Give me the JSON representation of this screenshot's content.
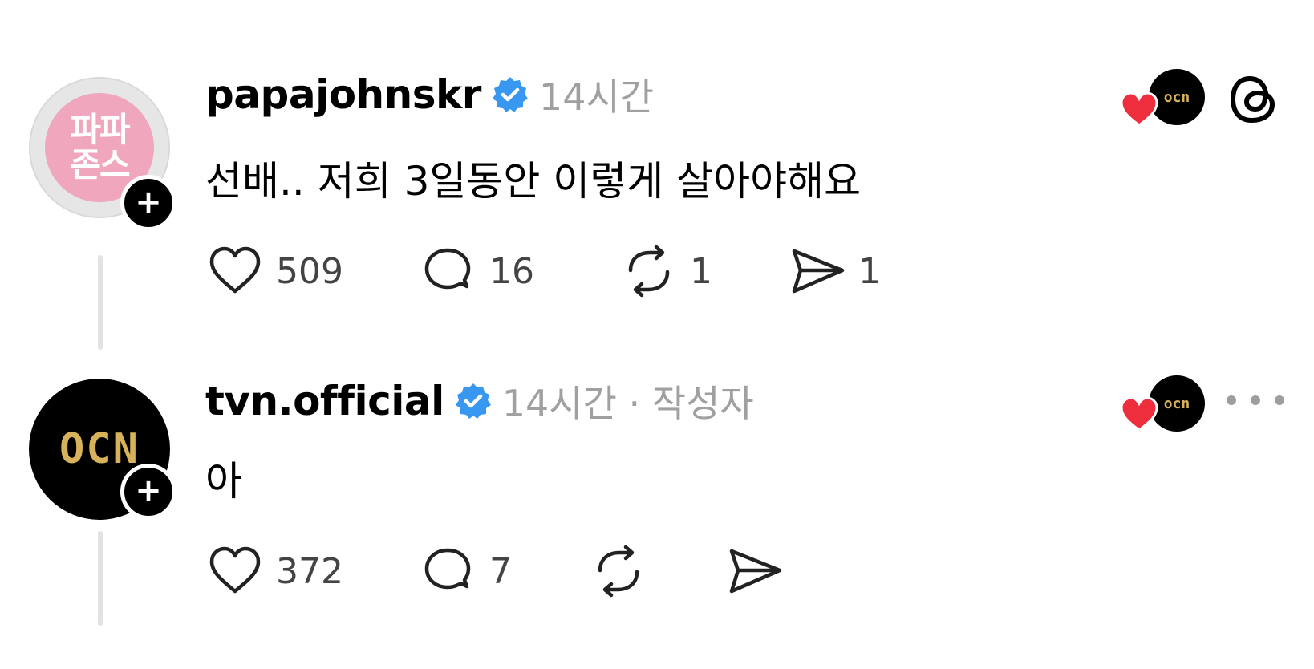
{
  "posts": [
    {
      "username": "papajohnskr",
      "time": "14시간",
      "text": "선배.. 저희 3일동안 이렇게 살아야해요",
      "avatar_text": [
        "파파",
        "존스"
      ],
      "top_right_avatar_text": "ocn",
      "actions": {
        "likes": "509",
        "comments": "16",
        "reposts": "1",
        "shares": "1"
      },
      "right_icon": "threads-logo-icon"
    },
    {
      "username": "tvn.official",
      "time": "14시간 · 작성자",
      "text": "아",
      "avatar_text": "OCN",
      "top_right_avatar_text": "ocn",
      "actions": {
        "likes": "372",
        "comments": "7",
        "reposts": "",
        "shares": ""
      },
      "right_icon": "more-icon"
    }
  ],
  "colors": {
    "verified": "#3897f0",
    "heart": "#ee2e3c",
    "muted": "#a0a0a0",
    "ocn_gold": "#d8b25a",
    "papa_pink": "#f0a6bc"
  }
}
